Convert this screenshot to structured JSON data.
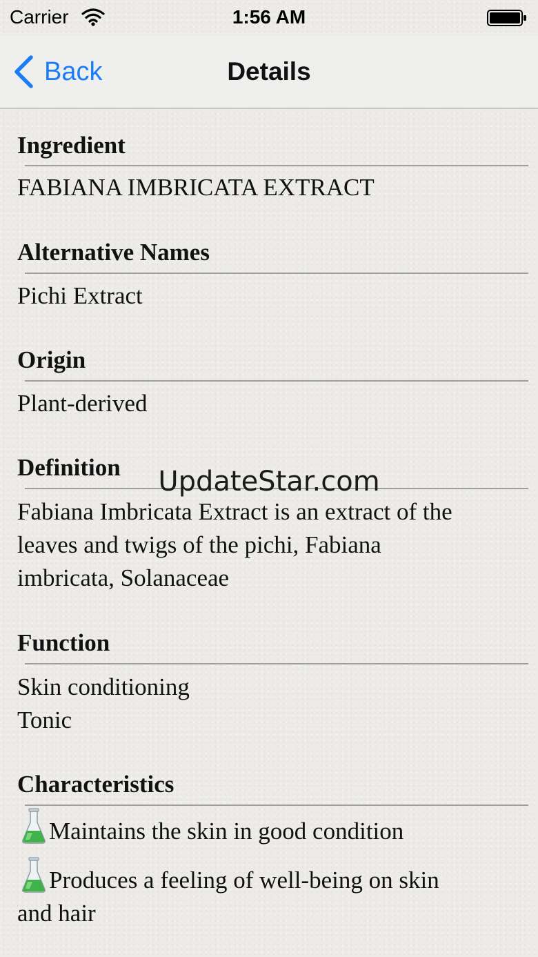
{
  "status_bar": {
    "carrier": "Carrier",
    "time": "1:56 AM",
    "wifi_icon": "wifi-icon",
    "battery_icon": "battery-icon"
  },
  "nav": {
    "back_label": "Back",
    "title": "Details",
    "accent_color": "#1a7df5"
  },
  "sections": {
    "ingredient": {
      "heading": "Ingredient",
      "value": "FABIANA IMBRICATA EXTRACT"
    },
    "alternative_names": {
      "heading": "Alternative Names",
      "value": "Pichi Extract"
    },
    "origin": {
      "heading": "Origin",
      "value": "Plant-derived"
    },
    "definition": {
      "heading": "Definition",
      "lines": [
        "Fabiana Imbricata Extract is an extract of the",
        "leaves and twigs of the pichi, Fabiana",
        "imbricata, Solanaceae"
      ]
    },
    "function": {
      "heading": "Function",
      "items": [
        "Skin conditioning",
        "Tonic"
      ]
    },
    "characteristics": {
      "heading": "Characteristics",
      "icon": "flask-icon",
      "items": [
        {
          "lines": [
            "Maintains the skin in good condition"
          ]
        },
        {
          "lines": [
            "Produces a feeling of well-being on skin",
            "and hair"
          ]
        }
      ]
    }
  },
  "watermark": "UpdateStar.com"
}
